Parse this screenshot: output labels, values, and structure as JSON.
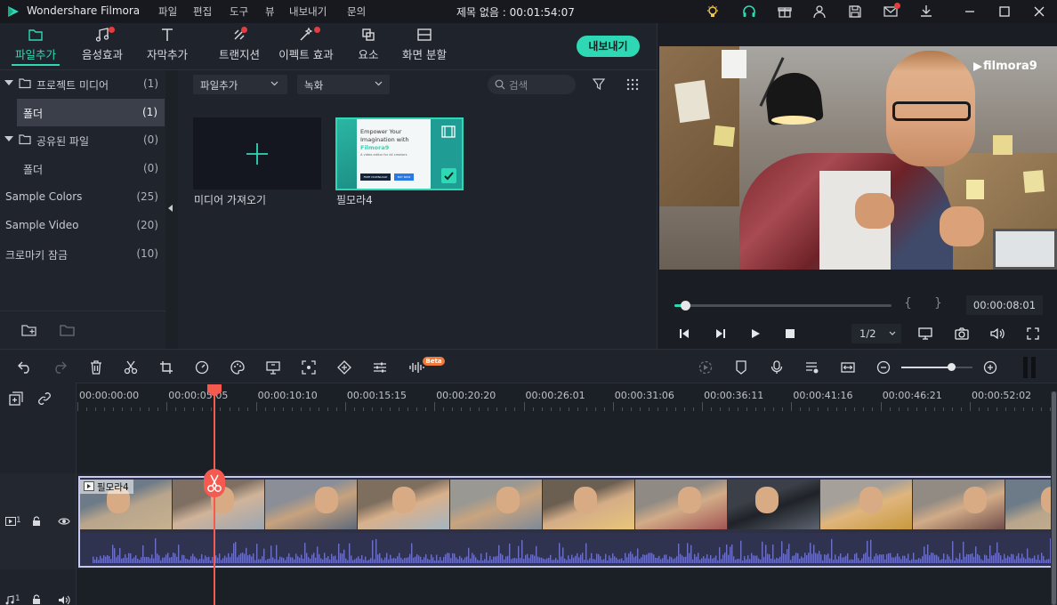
{
  "app": {
    "name": "Wondershare Filmora",
    "menu": [
      "파일",
      "편집",
      "도구",
      "뷰",
      "내보내기",
      "문의"
    ],
    "project_title": "제목 없음 : 00:01:54:07"
  },
  "tabs": [
    {
      "label": "파일추가",
      "active": true,
      "dot": false
    },
    {
      "label": "음성효과",
      "active": false,
      "dot": true
    },
    {
      "label": "자막추가",
      "active": false,
      "dot": false
    },
    {
      "label": "트랜지션",
      "active": false,
      "dot": true
    },
    {
      "label": "이펙트 효과",
      "active": false,
      "dot": true
    },
    {
      "label": "요소",
      "active": false,
      "dot": false
    },
    {
      "label": "화면 분할",
      "active": false,
      "dot": false
    }
  ],
  "export_button": "내보내기",
  "library": {
    "items": [
      {
        "label": "프로젝트 미디어",
        "count": "(1)",
        "folder": true,
        "indent": 0
      },
      {
        "label": "폴더",
        "count": "(1)",
        "folder": false,
        "indent": 1,
        "selected": true
      },
      {
        "label": "공유된 파일",
        "count": "(0)",
        "folder": true,
        "indent": 0
      },
      {
        "label": "폴더",
        "count": "(0)",
        "folder": false,
        "indent": 1
      },
      {
        "label": "Sample Colors",
        "count": "(25)",
        "folder": false,
        "indent": 0
      },
      {
        "label": "Sample Video",
        "count": "(20)",
        "folder": false,
        "indent": 0
      },
      {
        "label": "크로마키 잠금",
        "count": "(10)",
        "folder": false,
        "indent": 0
      }
    ]
  },
  "media": {
    "filter_dropdown": "파일추가",
    "record_dropdown": "녹화",
    "search_placeholder": "검색",
    "import_label": "미디어 가져오기",
    "clip_label": "필모라4",
    "clip_thumb": {
      "headline1": "Empower Your",
      "headline2": "Imagination with",
      "brand": "Filmora9",
      "sub": "A video editor for all creators",
      "btn1": "FREE DOWNLOAD",
      "btn2": "BUY NOW"
    }
  },
  "preview": {
    "watermark": "filmora9",
    "timecode": "00:00:08:01",
    "quality": "1/2",
    "progress": 0.05
  },
  "timeline": {
    "beta_badge": "Beta",
    "ruler": [
      "00:00:00:00",
      "00:00:05:05",
      "00:00:10:10",
      "00:00:15:15",
      "00:00:20:20",
      "00:00:26:01",
      "00:00:31:06",
      "00:00:36:11",
      "00:00:41:16",
      "00:00:46:21",
      "00:00:52:02"
    ],
    "clip_name": "필모라4",
    "video_track_label": "1",
    "audio_track_label": "1",
    "zoom": 0.7
  },
  "colors": {
    "accent": "#2fd8b5",
    "playhead": "#f45a4f",
    "timeline_clip_border": "#8b8fe0",
    "waveform": "#6c6fc7"
  }
}
